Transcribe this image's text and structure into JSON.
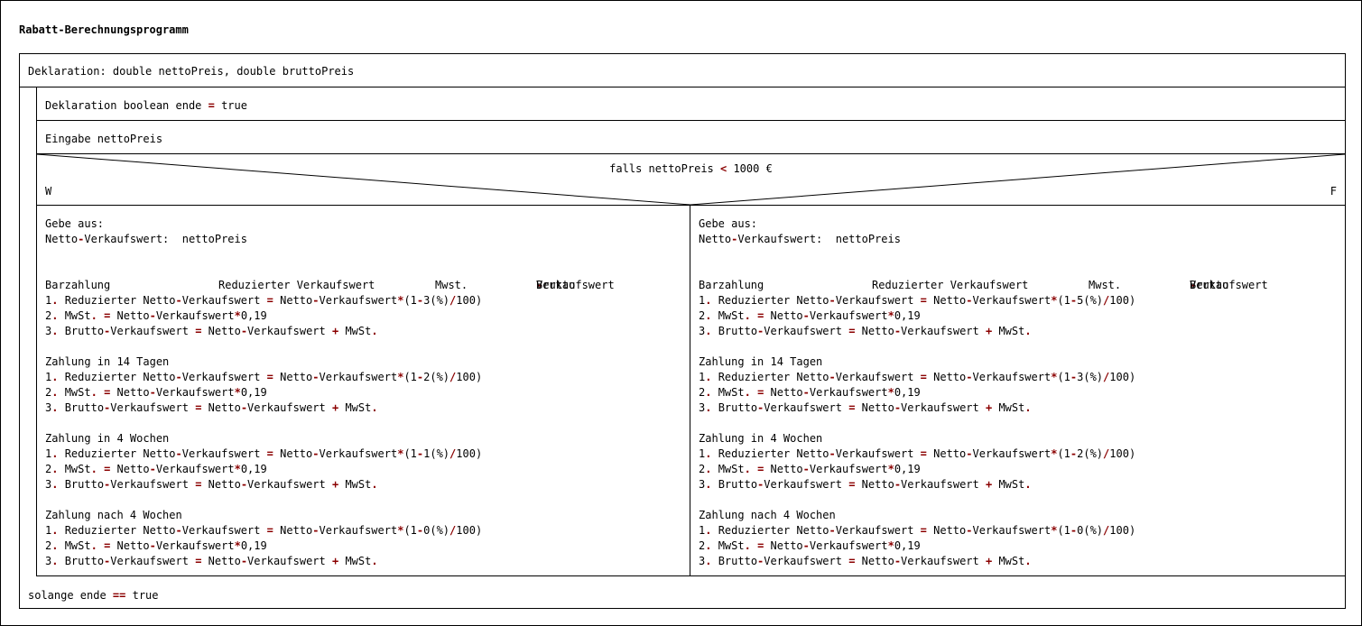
{
  "title": "Rabatt-Berechnungsprogramm",
  "declaration": "Deklaration: double nettoPreis, double bruttoPreis",
  "loop": {
    "ende_decl_prefix": "Deklaration boolean ende ",
    "ende_decl_op": "=",
    "ende_decl_value": " true",
    "input": "Eingabe nettoPreis",
    "condition_prefix": "falls nettoPreis ",
    "condition_op": "<",
    "condition_value": " 1000 €",
    "true_label": "W",
    "false_label": "F",
    "until_prefix": "solange ende ",
    "until_op": "==",
    "until_value": " true"
  },
  "columns": {
    "c1": "Barzahlung",
    "c2": "Reduzierter Verkaufswert",
    "c3": "Mwst.",
    "c4_a": "Brutto",
    "c4_dash": "-",
    "c4_b": "Verkaufswert"
  },
  "common": {
    "output_label": "Gebe aus:",
    "netto_a": "Netto",
    "dash": "-",
    "netto_b": "Verkaufswert:  nettoPreis",
    "n1": "1",
    "n2": "2",
    "n3": "3",
    "dot": ".",
    "reduz_a": " Reduzierter Netto",
    "reduz_b": "Verkaufswert ",
    "eq": "=",
    "netto_sp": " Netto",
    "vw": "Verkaufswert",
    "star": "*",
    "open": "(1",
    "pct": "(%)",
    "slash": "/",
    "hundred": "100)",
    "mwst_a": " MwSt",
    "mwst_b": "0,19",
    "brutto_a": " Brutto",
    "plus": "+",
    "mwst_end": " MwSt"
  },
  "branch_true": {
    "sections": [
      {
        "heading": "Barzahlung",
        "discount": "3"
      },
      {
        "heading": "Zahlung in 14 Tagen",
        "discount": "2"
      },
      {
        "heading": "Zahlung in 4 Wochen",
        "discount": "1"
      },
      {
        "heading": "Zahlung nach 4 Wochen",
        "discount": "0"
      }
    ]
  },
  "branch_false": {
    "sections": [
      {
        "heading": "Barzahlung",
        "discount": "5"
      },
      {
        "heading": "Zahlung in 14 Tagen",
        "discount": "3"
      },
      {
        "heading": "Zahlung in 4 Wochen",
        "discount": "2"
      },
      {
        "heading": "Zahlung nach 4 Wochen",
        "discount": "0"
      }
    ]
  }
}
